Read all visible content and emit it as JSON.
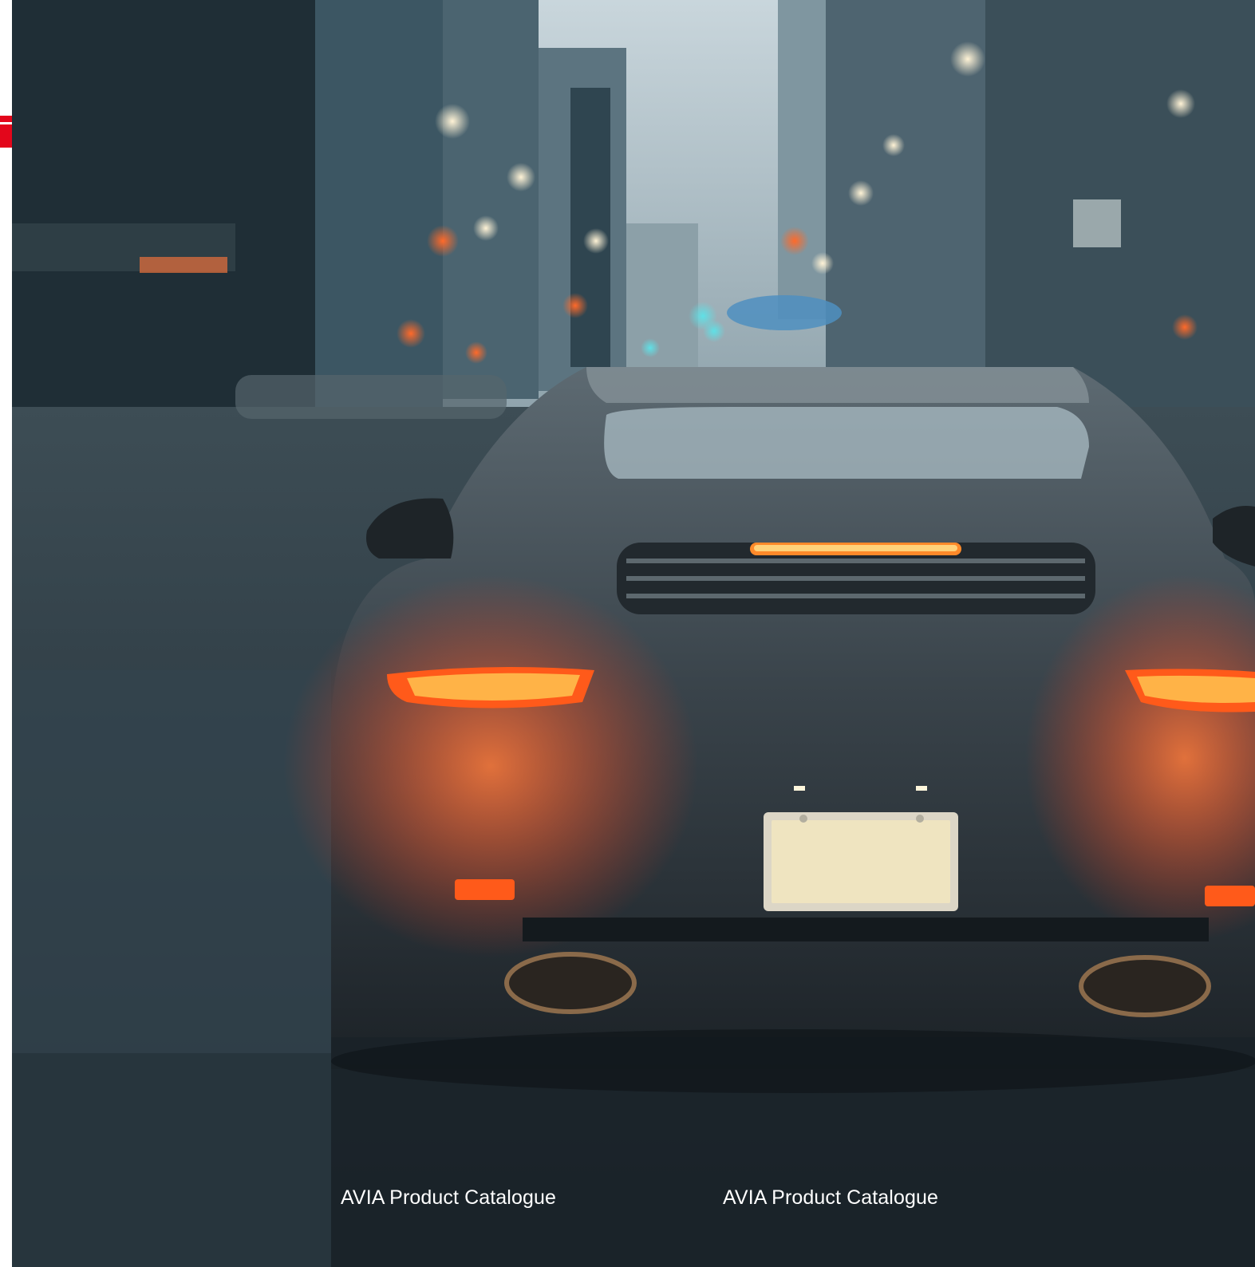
{
  "brand": {
    "accent_color": "#e3061b"
  },
  "photo": {
    "subject": "rear view of a sports car on a wet city street at dusk"
  },
  "footer": {
    "left_caption": "AVIA Product Catalogue",
    "right_caption": "AVIA Product Catalogue"
  }
}
